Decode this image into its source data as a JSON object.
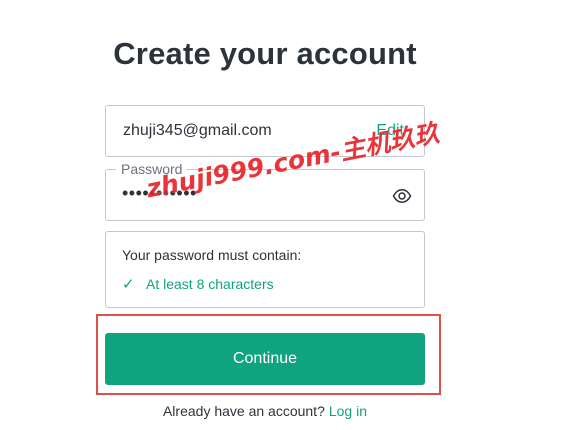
{
  "page": {
    "title": "Create your account"
  },
  "email": {
    "value": "zhuji345@gmail.com",
    "edit_label": "Edit"
  },
  "password": {
    "label": "Password",
    "masked_value": "•••••••••••",
    "toggle_icon": "eye-icon"
  },
  "requirements": {
    "title": "Your password must contain:",
    "items": [
      {
        "icon": "✓",
        "text": "At least 8 characters",
        "met": true
      }
    ]
  },
  "continue": {
    "label": "Continue"
  },
  "login": {
    "prompt": "Already have an account?",
    "link_label": "Log in"
  },
  "watermark": {
    "text": "zhuji999.com-主机玖玖"
  },
  "colors": {
    "accent": "#10a37f",
    "highlight_frame": "#e0504a",
    "watermark": "#e8232a",
    "border": "#c2c8d0",
    "text": "#2d333a"
  }
}
